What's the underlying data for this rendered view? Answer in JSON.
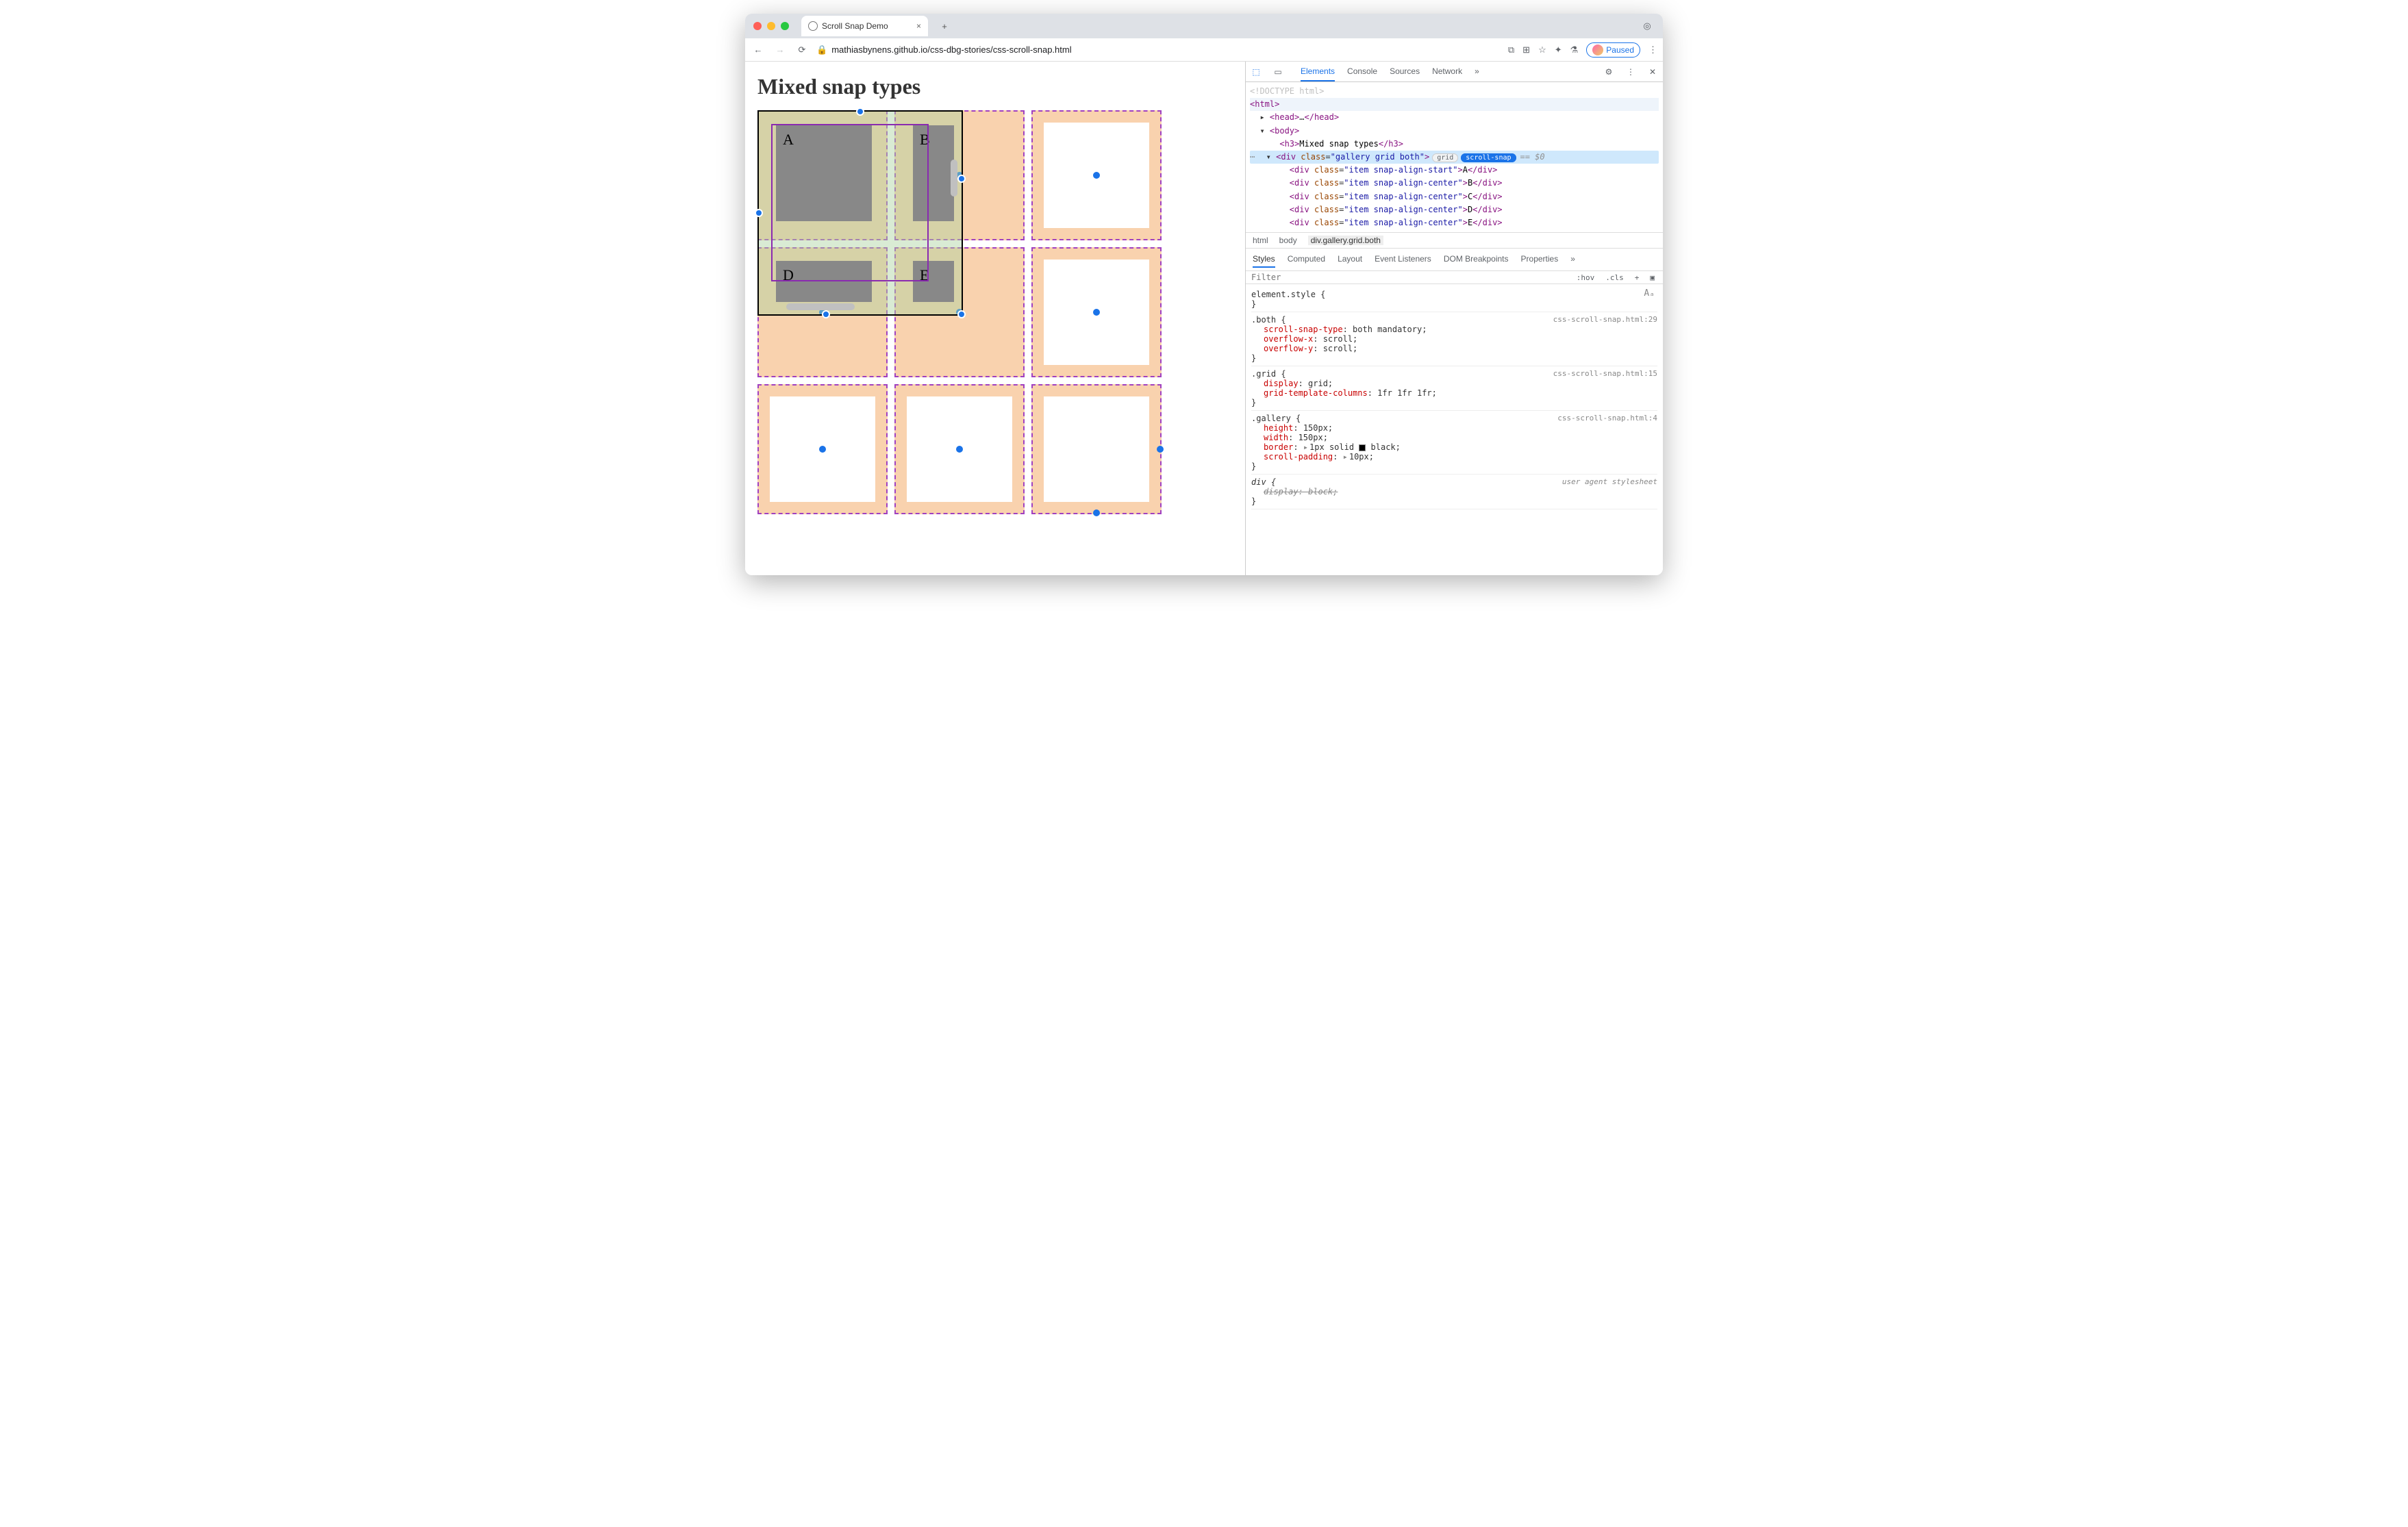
{
  "browser": {
    "tab_title": "Scroll Snap Demo",
    "url": "mathiasbynens.github.io/css-dbg-stories/css-scroll-snap.html",
    "paused_label": "Paused"
  },
  "page": {
    "heading": "Mixed snap types",
    "tiles": {
      "a": "A",
      "b": "B",
      "d": "D",
      "e": "E"
    }
  },
  "devtools": {
    "tabs": {
      "elements": "Elements",
      "console": "Console",
      "sources": "Sources",
      "network": "Network"
    },
    "dom": {
      "doctype": "<!DOCTYPE html>",
      "html_open": "<html>",
      "head": {
        "open": "<head>",
        "ellipsis": "…",
        "close": "</head>"
      },
      "body_open": "<body>",
      "h3": {
        "open": "<h3>",
        "text": "Mixed snap types",
        "close": "</h3>"
      },
      "gallery": {
        "tag": "div",
        "class_attr": "class",
        "class_val": "gallery grid both",
        "badge_grid": "grid",
        "badge_snap": "scroll-snap",
        "eq": "== $0"
      },
      "items": [
        {
          "class": "item snap-align-start",
          "text": "A"
        },
        {
          "class": "item snap-align-center",
          "text": "B"
        },
        {
          "class": "item snap-align-center",
          "text": "C"
        },
        {
          "class": "item snap-align-center",
          "text": "D"
        },
        {
          "class": "item snap-align-center",
          "text": "E"
        }
      ]
    },
    "crumbs": {
      "html": "html",
      "body": "body",
      "sel": "div.gallery.grid.both"
    },
    "style_tabs": {
      "styles": "Styles",
      "computed": "Computed",
      "layout": "Layout",
      "event": "Event Listeners",
      "domb": "DOM Breakpoints",
      "props": "Properties"
    },
    "filter": {
      "placeholder": "Filter",
      "hov": ":hov",
      "cls": ".cls"
    },
    "rules": {
      "element_style": "element.style {",
      "brace_close": "}",
      "both": {
        "sel": ".both {",
        "src": "css-scroll-snap.html:29",
        "p1n": "scroll-snap-type",
        "p1v": "both mandatory;",
        "p2n": "overflow-x",
        "p2v": "scroll;",
        "p3n": "overflow-y",
        "p3v": "scroll;"
      },
      "grid": {
        "sel": ".grid {",
        "src": "css-scroll-snap.html:15",
        "p1n": "display",
        "p1v": "grid;",
        "p2n": "grid-template-columns",
        "p2v": "1fr 1fr 1fr;"
      },
      "gallery": {
        "sel": ".gallery {",
        "src": "css-scroll-snap.html:4",
        "p1n": "height",
        "p1v": "150px;",
        "p2n": "width",
        "p2v": "150px;",
        "p3n": "border",
        "p3v": "1px solid ",
        "p3v2": "black;",
        "p4n": "scroll-padding",
        "p4v": "10px;"
      },
      "div": {
        "sel": "div {",
        "src": "user agent stylesheet",
        "p1n": "display",
        "p1v": "block;"
      }
    }
  }
}
